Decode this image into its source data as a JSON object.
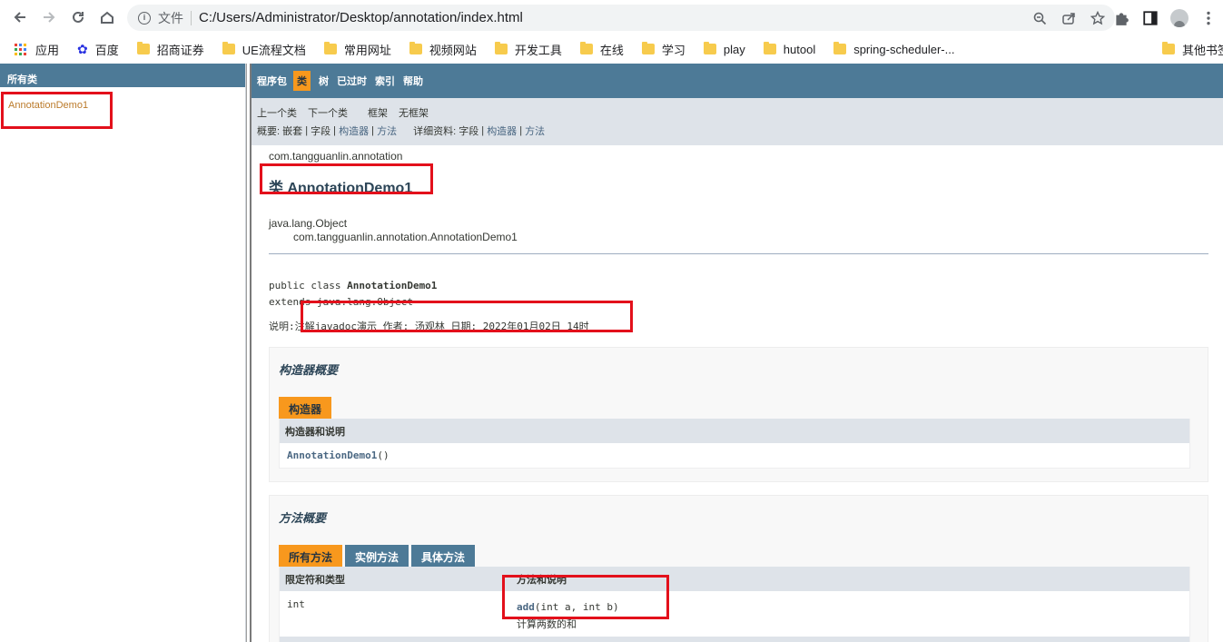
{
  "browser": {
    "omnibox_label": "文件",
    "url": "C:/Users/Administrator/Desktop/annotation/index.html"
  },
  "bookmarks": [
    "应用",
    "百度",
    "招商证券",
    "UE流程文档",
    "常用网址",
    "视频网站",
    "开发工具",
    "在线",
    "学习",
    "play",
    "hutool",
    "spring-scheduler-...",
    "其他书签"
  ],
  "left_frame": {
    "header": "所有类",
    "classes": [
      "AnnotationDemo1"
    ]
  },
  "topnav": {
    "items": [
      "程序包",
      "类",
      "树",
      "已过时",
      "索引",
      "帮助"
    ]
  },
  "subnav": {
    "prev_class": "上一个类",
    "next_class": "下一个类",
    "frames": "框架",
    "no_frames": "无框架",
    "summary_prefix": "概要:",
    "summary_nested": "嵌套",
    "summary_field": "字段",
    "summary_constr": "构造器",
    "summary_method": "方法",
    "detail_prefix": "详细资料:",
    "detail_field": "字段",
    "detail_constr": "构造器",
    "detail_method": "方法",
    "sep": "|"
  },
  "content": {
    "package": "com.tangguanlin.annotation",
    "title": "类 AnnotationDemo1",
    "inherit_parent": "java.lang.Object",
    "inherit_child": "com.tangguanlin.annotation.AnnotationDemo1",
    "decl_line1_prefix": "public class ",
    "decl_class": "AnnotationDemo1",
    "decl_line2": "extends java.lang.Object",
    "desc_label": "说明:",
    "desc_text": "注解javadoc演示 作者: 汤观林 日期: 2022年01月02日 14时"
  },
  "constructor_summary": {
    "heading": "构造器概要",
    "tab": "构造器",
    "column": "构造器和说明",
    "row_name": "AnnotationDemo1",
    "row_params": "()"
  },
  "method_summary": {
    "heading": "方法概要",
    "tabs": [
      "所有方法",
      "实例方法",
      "具体方法"
    ],
    "columns": [
      "限定符和类型",
      "方法和说明"
    ],
    "rows": [
      {
        "type": "int",
        "name": "add",
        "params": "(int  a, int  b)",
        "desc": "计算两数的和"
      }
    ]
  },
  "colors": {
    "nav_blue": "#4d7a97",
    "nav_orange": "#f8981d",
    "subnav_gray": "#dee3e9",
    "annotation_red": "#e3101b"
  }
}
